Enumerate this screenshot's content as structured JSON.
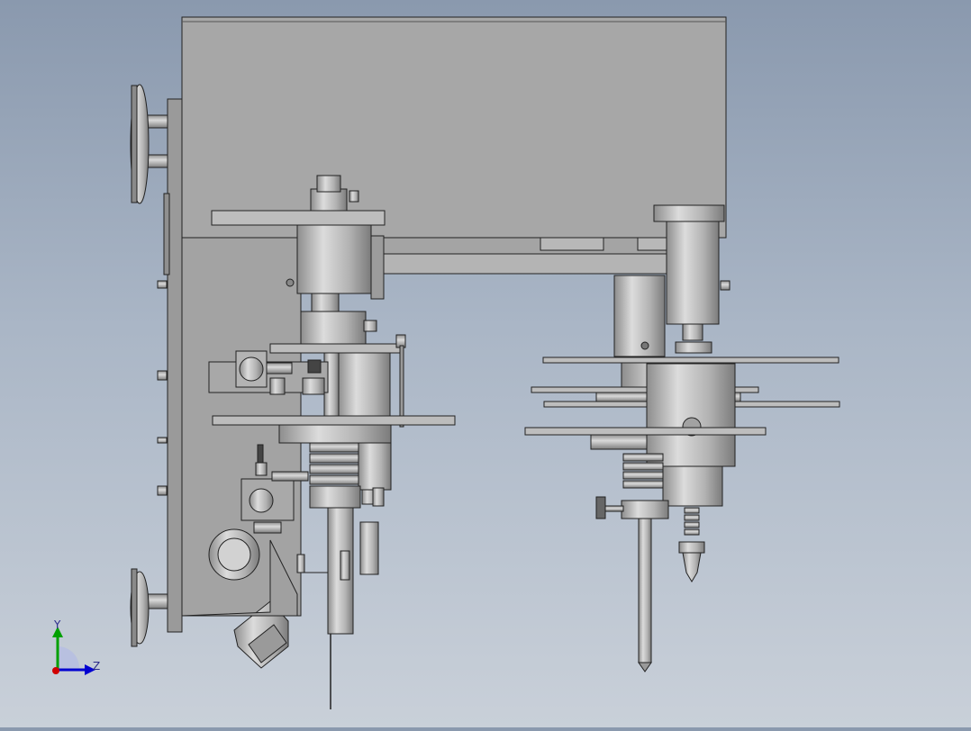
{
  "viewport": {
    "background_top": "#8a99ae",
    "background_bottom": "#c9d0d9",
    "model_color": "#a9a9a9",
    "edge_color": "#222222"
  },
  "triad": {
    "y_label": "Y",
    "z_label": "Z",
    "x_color": "#d00000",
    "y_color": "#00a000",
    "z_color": "#0000d0"
  }
}
